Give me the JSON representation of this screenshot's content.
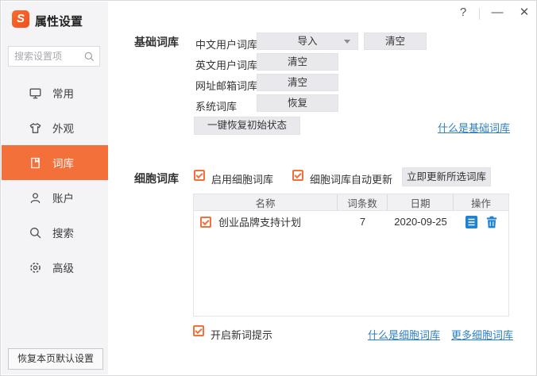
{
  "window": {
    "title": "属性设置",
    "controls": {
      "help": "?",
      "minimize": "—",
      "close": "✕"
    }
  },
  "colors": {
    "accent_orange": "#f4703a",
    "link_blue": "#2e7fc1",
    "action_icon_blue": "#1e82d2",
    "button_gray": "#e9e9ed",
    "sidebar_gray": "#f4f4f6"
  },
  "sidebar": {
    "logo_letter": "S",
    "search_placeholder": "搜索设置项",
    "items": [
      {
        "id": "common",
        "label": "常用",
        "icon": "monitor-icon",
        "selected": false
      },
      {
        "id": "appearance",
        "label": "外观",
        "icon": "shirt-icon",
        "selected": false
      },
      {
        "id": "lexicon",
        "label": "词库",
        "icon": "book-icon",
        "selected": true
      },
      {
        "id": "account",
        "label": "账户",
        "icon": "person-icon",
        "selected": false
      },
      {
        "id": "search",
        "label": "搜索",
        "icon": "search-icon",
        "selected": false
      },
      {
        "id": "advanced",
        "label": "高级",
        "icon": "gear-icon",
        "selected": false
      }
    ],
    "restore_button": "恢复本页默认设置"
  },
  "basic": {
    "section_label": "基础词库",
    "rows": [
      {
        "label": "中文用户词库",
        "import_button": "导入",
        "clear_button": "清空"
      },
      {
        "label": "英文用户词库",
        "clear_button": "清空"
      },
      {
        "label": "网址邮箱词库",
        "clear_button": "清空"
      },
      {
        "label": "系统词库",
        "restore_button": "恢复"
      }
    ],
    "restore_all_button": "一键恢复初始状态",
    "help_link": "什么是基础词库"
  },
  "cell": {
    "section_label": "细胞词库",
    "enable_checkbox_label": "启用细胞词库",
    "auto_update_checkbox_label": "细胞词库自动更新",
    "update_button": "立即更新所选词库",
    "table": {
      "headers": [
        "名称",
        "词条数",
        "日期",
        "操作"
      ],
      "rows": [
        {
          "checked": true,
          "name": "创业品牌支持计划",
          "word_count": "7",
          "date": "2020-09-25"
        }
      ]
    },
    "new_word_checkbox_label": "开启新词提示",
    "what_link": "什么是细胞词库",
    "more_link": "更多细胞词库"
  }
}
